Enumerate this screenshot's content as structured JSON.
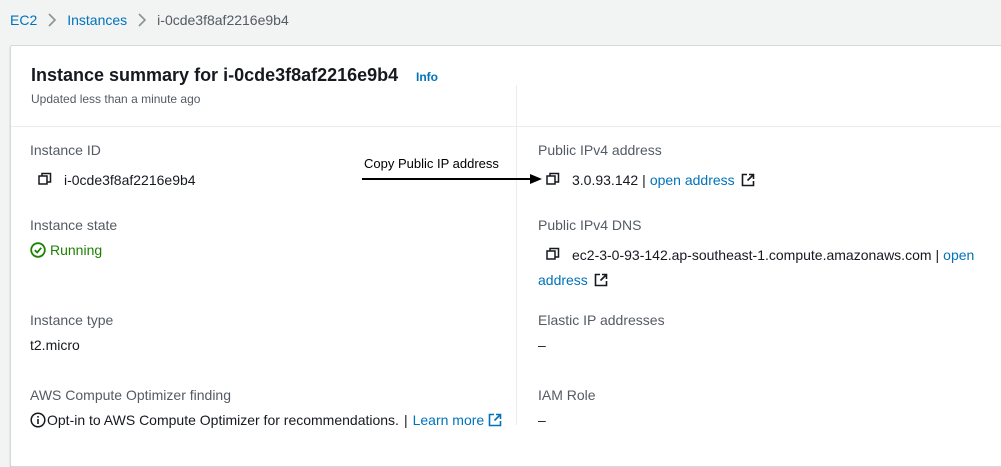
{
  "breadcrumb": {
    "items": [
      "EC2",
      "Instances"
    ],
    "current": "i-0cde3f8af2216e9b4"
  },
  "summary": {
    "title": "Instance summary for i-0cde3f8af2216e9b4",
    "info_label": "Info",
    "subtitle": "Updated less than a minute ago"
  },
  "fields": {
    "instance_id": {
      "label": "Instance ID",
      "value": "i-0cde3f8af2216e9b4"
    },
    "public_ipv4": {
      "label": "Public IPv4 address",
      "value": "3.0.93.142",
      "separator": "|",
      "link": "open address"
    },
    "instance_state": {
      "label": "Instance state",
      "value": "Running"
    },
    "public_dns": {
      "label": "Public IPv4 DNS",
      "value": "ec2-3-0-93-142.ap-southeast-1.compute.amazonaws.com",
      "separator": "|",
      "link_part1": "open",
      "link_part2": "address"
    },
    "instance_type": {
      "label": "Instance type",
      "value": "t2.micro"
    },
    "elastic_ip": {
      "label": "Elastic IP addresses",
      "value": "–"
    },
    "optimizer": {
      "label": "AWS Compute Optimizer finding",
      "value": "Opt-in to AWS Compute Optimizer for recommendations.",
      "separator": "|",
      "link": "Learn more"
    },
    "iam_role": {
      "label": "IAM Role",
      "value": "–"
    }
  },
  "annotation": {
    "text": "Copy Public IP address"
  },
  "colors": {
    "link": "#0073bb",
    "running": "#1d8102",
    "label": "#545b64"
  },
  "icons": [
    "chevron-right-icon",
    "copy-icon",
    "external-link-icon",
    "check-circle-icon",
    "info-circle-icon",
    "arrow-right-icon"
  ]
}
